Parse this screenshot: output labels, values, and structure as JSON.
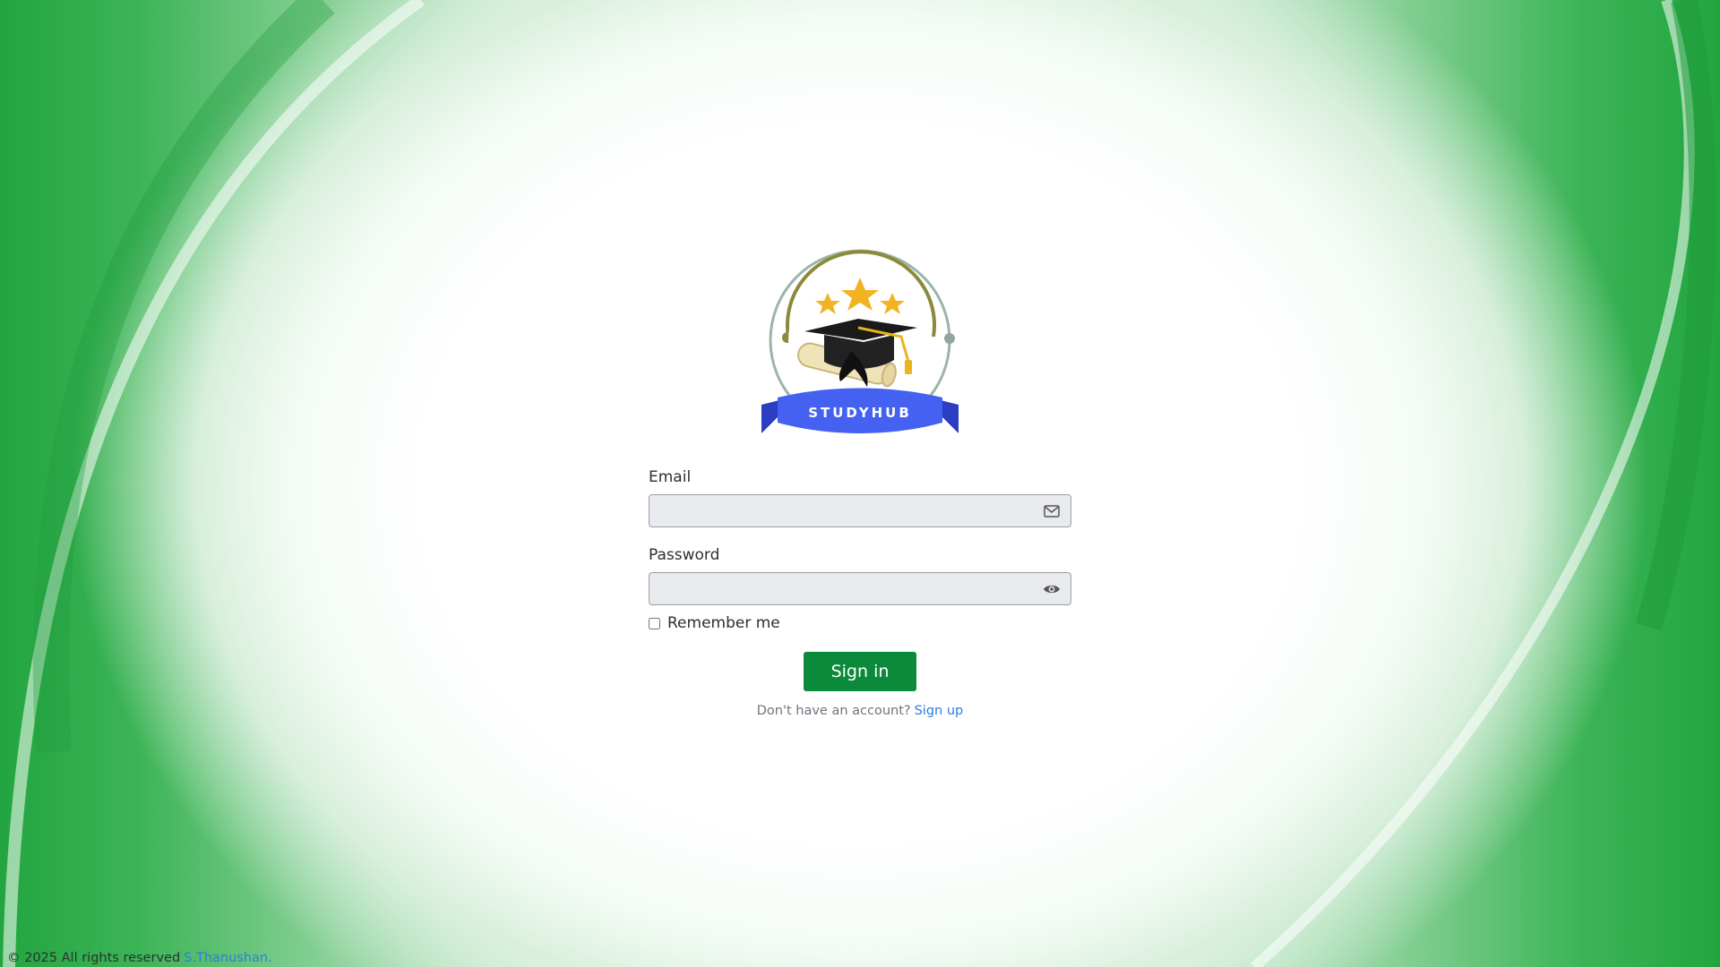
{
  "logo": {
    "banner_text": "STUDYHUB",
    "colors": {
      "ring": "#8aa898",
      "ring_inner": "#8a8a3a",
      "stars": "#f2b321",
      "cap": "#1a1a1a",
      "banner": "#4561f2",
      "banner_dark": "#2c3fc4"
    }
  },
  "form": {
    "email_label": "Email",
    "email_value": "",
    "email_icon": "envelope-icon",
    "password_label": "Password",
    "password_value": "",
    "password_icon": "eye-icon",
    "remember_label": "Remember me",
    "remember_checked": false,
    "signin_label": "Sign in",
    "signup_prompt": "Don't have an account?",
    "signup_link": "Sign up"
  },
  "footer": {
    "copyright": "© 2025 All rights reserved",
    "author_link": "S.Thanushan."
  },
  "colors": {
    "primary_button": "#0a8a3a",
    "link": "#2b7de0",
    "background_green": "#22a540"
  }
}
